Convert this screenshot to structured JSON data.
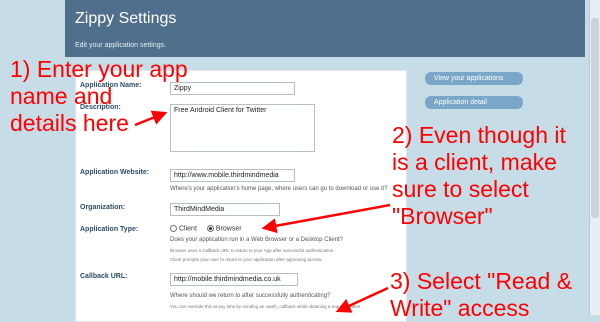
{
  "header": {
    "title": "Zippy Settings",
    "subtitle": "Edit your application settings."
  },
  "sidebar": {
    "buttons": [
      {
        "label": "View your applications"
      },
      {
        "label": "Application detail"
      }
    ]
  },
  "form": {
    "app_name": {
      "label": "Application Name:",
      "value": "Zippy"
    },
    "description": {
      "label": "Description:",
      "value": "Free Android Client for Twitter"
    },
    "website": {
      "label": "Application Website:",
      "value": "http://www.mobile.thirdmindmedia",
      "help": "Where's your application's home page, where users can go to download or use it?"
    },
    "organization": {
      "label": "Organization:",
      "value": "ThirdMindMedia"
    },
    "app_type": {
      "label": "Application Type:",
      "options": [
        "Client",
        "Browser"
      ],
      "selected": "Browser",
      "help": "Does your application run in a Web Browser or a Desktop Client?",
      "help_small_1": "Browser uses a Callback URL to return to your App after successful authentication.",
      "help_small_2": "Client prompts your user to return to your application after approving access."
    },
    "callback": {
      "label": "Callback URL:",
      "value": "http://mobile.thirdmindmedia.co.uk",
      "help": "Where should we return to after successfully authenticating?",
      "help_small": "You can override this at any time by sending an oauth_callback while obtaining a request_token"
    }
  },
  "annotations": {
    "step1": "1) Enter your app\nname and\ndetails here",
    "step2": "2) Even though it\nis a client, make\nsure to select\n\"Browser\"",
    "step3": "3) Select \"Read &\nWrite\" access"
  },
  "colors": {
    "header_bg": "#4f6f8d",
    "page_bg": "#c6dde8",
    "annotation": "#ff0000",
    "side_button": "#7aa6c7"
  }
}
